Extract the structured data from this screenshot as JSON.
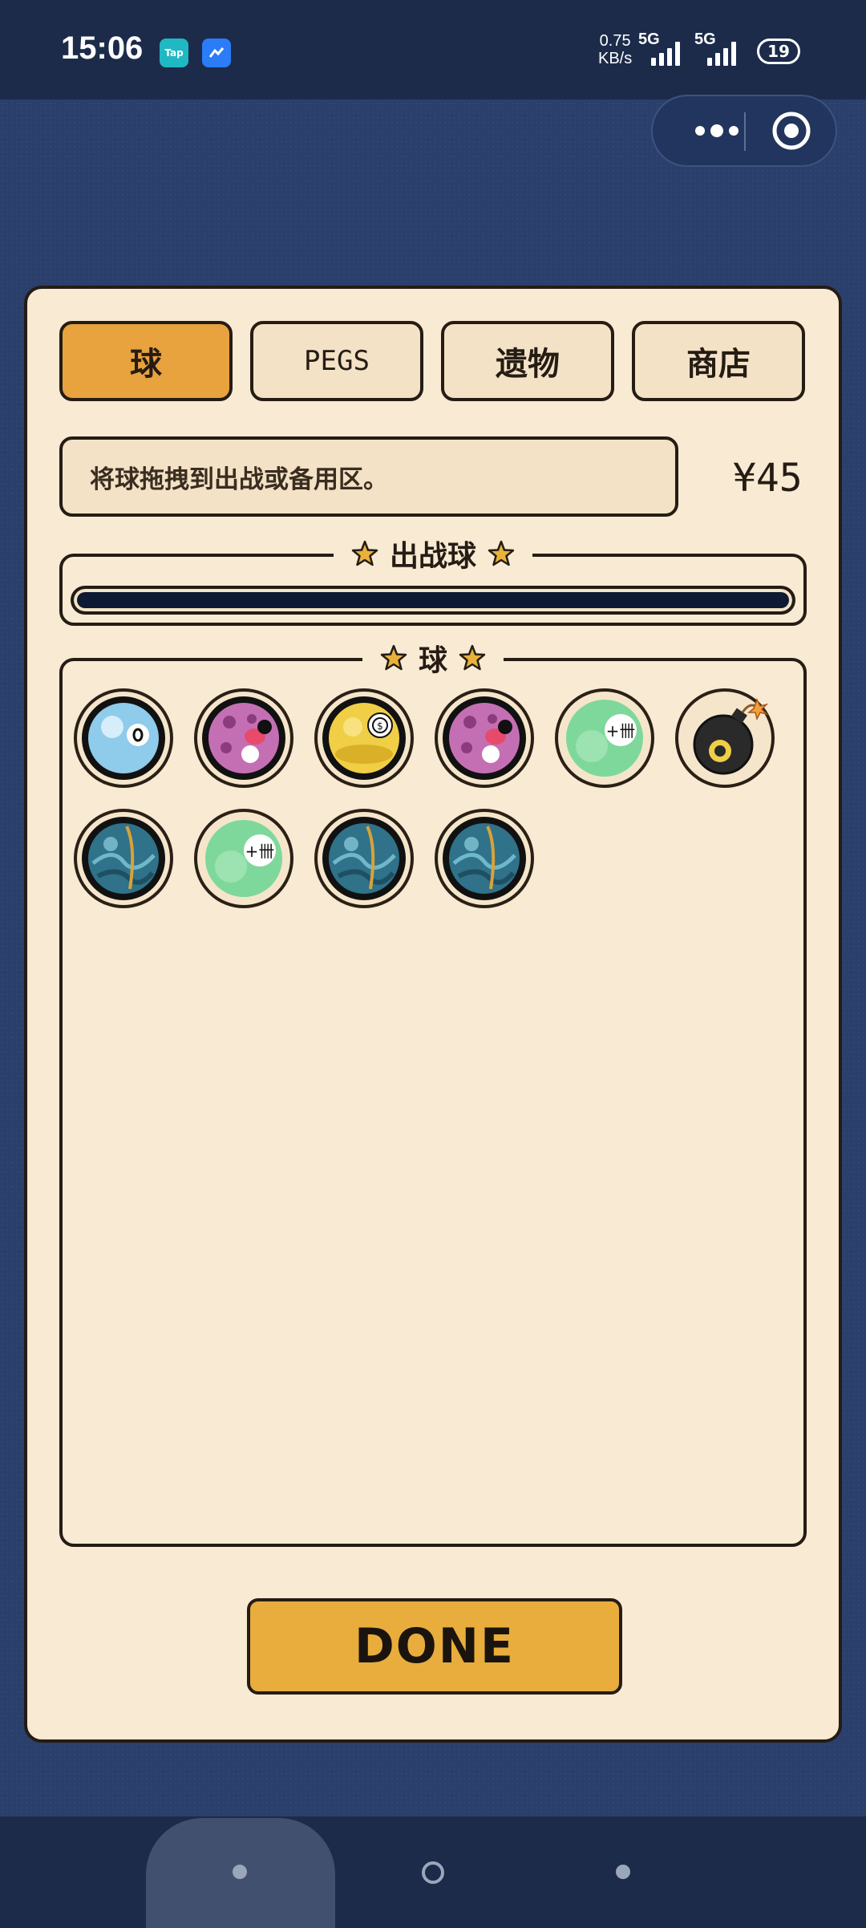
{
  "status_bar": {
    "time": "15:06",
    "app_icons": [
      "Tap",
      "arrow-app"
    ],
    "net_speed_value": "0.75",
    "net_speed_unit": "KB/s",
    "signal1_label": "5G",
    "signal2_label": "5G",
    "battery": "19"
  },
  "tabs": [
    {
      "label": "球",
      "active": true
    },
    {
      "label": "PEGS",
      "active": false
    },
    {
      "label": "遗物",
      "active": false
    },
    {
      "label": "商店",
      "active": false
    }
  ],
  "hint": "将球拖拽到出战或备用区。",
  "money": "¥45",
  "active_section": {
    "title": "出战球"
  },
  "ball_section": {
    "title": "球"
  },
  "balls": [
    {
      "type": "eight-ball-blue"
    },
    {
      "type": "pink-dice-ball"
    },
    {
      "type": "gold-coin-ball"
    },
    {
      "type": "pink-dice-ball"
    },
    {
      "type": "green-tally-ball"
    },
    {
      "type": "bomb"
    },
    {
      "type": "ocean-ball"
    },
    {
      "type": "green-tally-ball"
    },
    {
      "type": "ocean-ball"
    },
    {
      "type": "ocean-ball"
    }
  ],
  "done_button": "DONE",
  "colors": {
    "panel": "#f8ead3",
    "accent": "#e8a23e",
    "done": "#e8ad3c",
    "outline": "#251c14",
    "background": "#2a3f6b"
  }
}
